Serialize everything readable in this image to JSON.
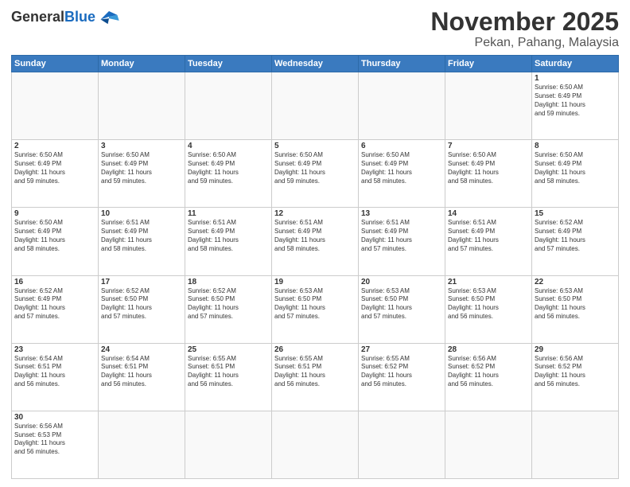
{
  "logo": {
    "general": "General",
    "blue": "Blue"
  },
  "title": "November 2025",
  "subtitle": "Pekan, Pahang, Malaysia",
  "weekdays": [
    "Sunday",
    "Monday",
    "Tuesday",
    "Wednesday",
    "Thursday",
    "Friday",
    "Saturday"
  ],
  "weeks": [
    [
      {
        "day": "",
        "info": ""
      },
      {
        "day": "",
        "info": ""
      },
      {
        "day": "",
        "info": ""
      },
      {
        "day": "",
        "info": ""
      },
      {
        "day": "",
        "info": ""
      },
      {
        "day": "",
        "info": ""
      },
      {
        "day": "1",
        "info": "Sunrise: 6:50 AM\nSunset: 6:49 PM\nDaylight: 11 hours\nand 59 minutes."
      }
    ],
    [
      {
        "day": "2",
        "info": "Sunrise: 6:50 AM\nSunset: 6:49 PM\nDaylight: 11 hours\nand 59 minutes."
      },
      {
        "day": "3",
        "info": "Sunrise: 6:50 AM\nSunset: 6:49 PM\nDaylight: 11 hours\nand 59 minutes."
      },
      {
        "day": "4",
        "info": "Sunrise: 6:50 AM\nSunset: 6:49 PM\nDaylight: 11 hours\nand 59 minutes."
      },
      {
        "day": "5",
        "info": "Sunrise: 6:50 AM\nSunset: 6:49 PM\nDaylight: 11 hours\nand 59 minutes."
      },
      {
        "day": "6",
        "info": "Sunrise: 6:50 AM\nSunset: 6:49 PM\nDaylight: 11 hours\nand 58 minutes."
      },
      {
        "day": "7",
        "info": "Sunrise: 6:50 AM\nSunset: 6:49 PM\nDaylight: 11 hours\nand 58 minutes."
      },
      {
        "day": "8",
        "info": "Sunrise: 6:50 AM\nSunset: 6:49 PM\nDaylight: 11 hours\nand 58 minutes."
      }
    ],
    [
      {
        "day": "9",
        "info": "Sunrise: 6:50 AM\nSunset: 6:49 PM\nDaylight: 11 hours\nand 58 minutes."
      },
      {
        "day": "10",
        "info": "Sunrise: 6:51 AM\nSunset: 6:49 PM\nDaylight: 11 hours\nand 58 minutes."
      },
      {
        "day": "11",
        "info": "Sunrise: 6:51 AM\nSunset: 6:49 PM\nDaylight: 11 hours\nand 58 minutes."
      },
      {
        "day": "12",
        "info": "Sunrise: 6:51 AM\nSunset: 6:49 PM\nDaylight: 11 hours\nand 58 minutes."
      },
      {
        "day": "13",
        "info": "Sunrise: 6:51 AM\nSunset: 6:49 PM\nDaylight: 11 hours\nand 57 minutes."
      },
      {
        "day": "14",
        "info": "Sunrise: 6:51 AM\nSunset: 6:49 PM\nDaylight: 11 hours\nand 57 minutes."
      },
      {
        "day": "15",
        "info": "Sunrise: 6:52 AM\nSunset: 6:49 PM\nDaylight: 11 hours\nand 57 minutes."
      }
    ],
    [
      {
        "day": "16",
        "info": "Sunrise: 6:52 AM\nSunset: 6:49 PM\nDaylight: 11 hours\nand 57 minutes."
      },
      {
        "day": "17",
        "info": "Sunrise: 6:52 AM\nSunset: 6:50 PM\nDaylight: 11 hours\nand 57 minutes."
      },
      {
        "day": "18",
        "info": "Sunrise: 6:52 AM\nSunset: 6:50 PM\nDaylight: 11 hours\nand 57 minutes."
      },
      {
        "day": "19",
        "info": "Sunrise: 6:53 AM\nSunset: 6:50 PM\nDaylight: 11 hours\nand 57 minutes."
      },
      {
        "day": "20",
        "info": "Sunrise: 6:53 AM\nSunset: 6:50 PM\nDaylight: 11 hours\nand 57 minutes."
      },
      {
        "day": "21",
        "info": "Sunrise: 6:53 AM\nSunset: 6:50 PM\nDaylight: 11 hours\nand 56 minutes."
      },
      {
        "day": "22",
        "info": "Sunrise: 6:53 AM\nSunset: 6:50 PM\nDaylight: 11 hours\nand 56 minutes."
      }
    ],
    [
      {
        "day": "23",
        "info": "Sunrise: 6:54 AM\nSunset: 6:51 PM\nDaylight: 11 hours\nand 56 minutes."
      },
      {
        "day": "24",
        "info": "Sunrise: 6:54 AM\nSunset: 6:51 PM\nDaylight: 11 hours\nand 56 minutes."
      },
      {
        "day": "25",
        "info": "Sunrise: 6:55 AM\nSunset: 6:51 PM\nDaylight: 11 hours\nand 56 minutes."
      },
      {
        "day": "26",
        "info": "Sunrise: 6:55 AM\nSunset: 6:51 PM\nDaylight: 11 hours\nand 56 minutes."
      },
      {
        "day": "27",
        "info": "Sunrise: 6:55 AM\nSunset: 6:52 PM\nDaylight: 11 hours\nand 56 minutes."
      },
      {
        "day": "28",
        "info": "Sunrise: 6:56 AM\nSunset: 6:52 PM\nDaylight: 11 hours\nand 56 minutes."
      },
      {
        "day": "29",
        "info": "Sunrise: 6:56 AM\nSunset: 6:52 PM\nDaylight: 11 hours\nand 56 minutes."
      }
    ],
    [
      {
        "day": "30",
        "info": "Sunrise: 6:56 AM\nSunset: 6:53 PM\nDaylight: 11 hours\nand 56 minutes."
      },
      {
        "day": "",
        "info": ""
      },
      {
        "day": "",
        "info": ""
      },
      {
        "day": "",
        "info": ""
      },
      {
        "day": "",
        "info": ""
      },
      {
        "day": "",
        "info": ""
      },
      {
        "day": "",
        "info": ""
      }
    ]
  ]
}
